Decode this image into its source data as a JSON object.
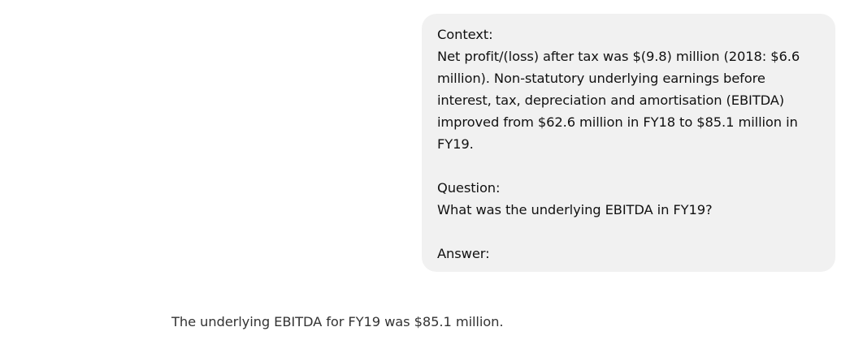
{
  "conversation": {
    "user_message": "Context:\nNet profit/(loss) after tax was $(9.8) million (2018: $6.6 million). Non-statutory underlying earnings before interest, tax, depreciation and amortisation (EBITDA) improved from $62.6 million in FY18 to $85.1 million in FY19.\n\nQuestion:\nWhat was the underlying EBITDA in FY19?\n\nAnswer:",
    "assistant_message": "The underlying EBITDA for FY19 was $85.1 million."
  },
  "colors": {
    "user_bubble_bg": "#f1f1f1",
    "page_bg": "#ffffff",
    "assistant_text": "#333333"
  }
}
